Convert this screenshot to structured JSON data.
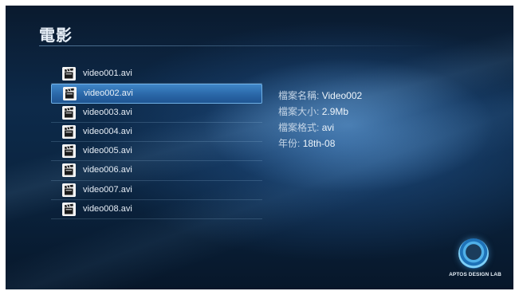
{
  "header": {
    "title": "電影"
  },
  "file_list": {
    "selected_index": 1,
    "items": [
      {
        "label": "video001.avi",
        "icon": "clapperboard-icon"
      },
      {
        "label": "video002.avi",
        "icon": "clapperboard-icon"
      },
      {
        "label": "video003.avi",
        "icon": "clapperboard-icon"
      },
      {
        "label": "video004.avi",
        "icon": "clapperboard-icon"
      },
      {
        "label": "video005.avi",
        "icon": "clapperboard-icon"
      },
      {
        "label": "video006.avi",
        "icon": "clapperboard-icon"
      },
      {
        "label": "video007.avi",
        "icon": "clapperboard-icon"
      },
      {
        "label": "video008.avi",
        "icon": "clapperboard-icon"
      }
    ]
  },
  "details": {
    "name_key": "檔案名稱:",
    "name_val": "Video002",
    "size_key": "檔案大小:",
    "size_val": "2.9Mb",
    "format_key": "檔案格式:",
    "format_val": "avi",
    "year_key": "年份:",
    "year_val": "18th-08"
  },
  "brand": {
    "text": "APTOS DESIGN LAB",
    "icon": "aptos-logo-icon"
  },
  "colors": {
    "background": "#0d2a4a",
    "selection": "#2f72b5",
    "selection_border": "#6fb0e6",
    "text": "#e7eef6"
  }
}
